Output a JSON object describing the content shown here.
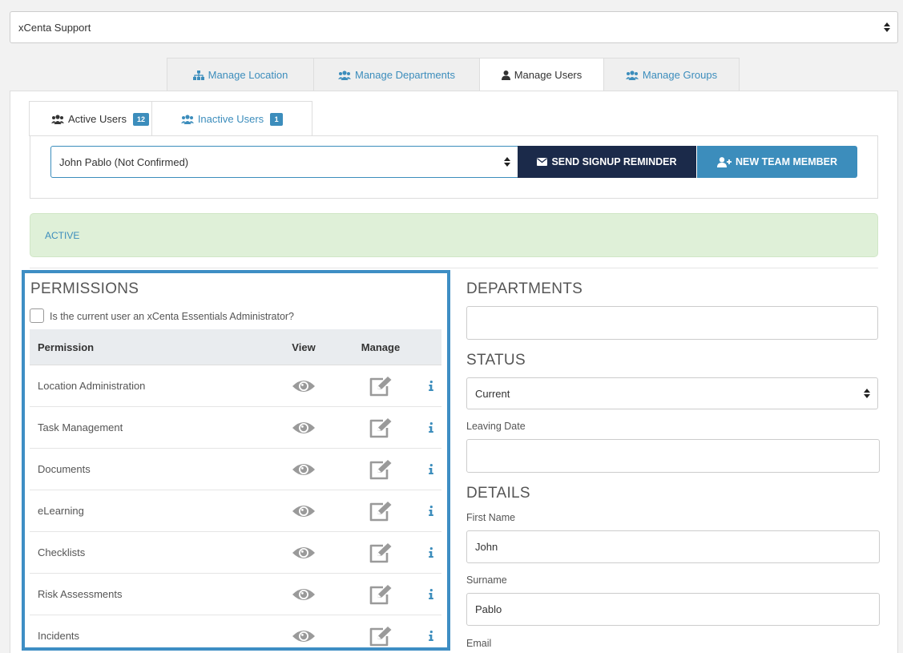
{
  "company": {
    "selected": "xCenta Support"
  },
  "main_tabs": [
    {
      "label": "Manage Location",
      "icon": "sitemap-icon",
      "active": false
    },
    {
      "label": "Manage Departments",
      "icon": "users-icon",
      "active": false
    },
    {
      "label": "Manage Users",
      "icon": "user-icon",
      "active": true
    },
    {
      "label": "Manage Groups",
      "icon": "users-icon",
      "active": false
    }
  ],
  "user_tabs": {
    "active": {
      "label": "Active Users",
      "count": "12"
    },
    "inactive": {
      "label": "Inactive Users",
      "count": "1"
    }
  },
  "user_picker": {
    "selected": "John Pablo (Not Confirmed)",
    "reminder_label": "SEND SIGNUP REMINDER",
    "new_member_label": "NEW TEAM MEMBER"
  },
  "status_banner": "ACTIVE",
  "permissions": {
    "title": "PERMISSIONS",
    "admin_question": "Is the current user an xCenta Essentials Administrator?",
    "admin_checked": false,
    "columns": {
      "permission": "Permission",
      "view": "View",
      "manage": "Manage"
    },
    "rows": [
      {
        "name": "Location Administration"
      },
      {
        "name": "Task Management"
      },
      {
        "name": "Documents"
      },
      {
        "name": "eLearning"
      },
      {
        "name": "Checklists"
      },
      {
        "name": "Risk Assessments"
      },
      {
        "name": "Incidents"
      }
    ]
  },
  "departments": {
    "title": "DEPARTMENTS",
    "value": ""
  },
  "status": {
    "title": "STATUS",
    "selected": "Current",
    "leaving_date_label": "Leaving Date",
    "leaving_date": ""
  },
  "details": {
    "title": "DETAILS",
    "first_name_label": "First Name",
    "first_name": "John",
    "surname_label": "Surname",
    "surname": "Pablo",
    "email_label": "Email"
  },
  "colors": {
    "primary": "#3c8dbc",
    "navy": "#1b2a4a",
    "success_bg": "#dff0d8",
    "highlight_border": "#3e8ec4"
  }
}
